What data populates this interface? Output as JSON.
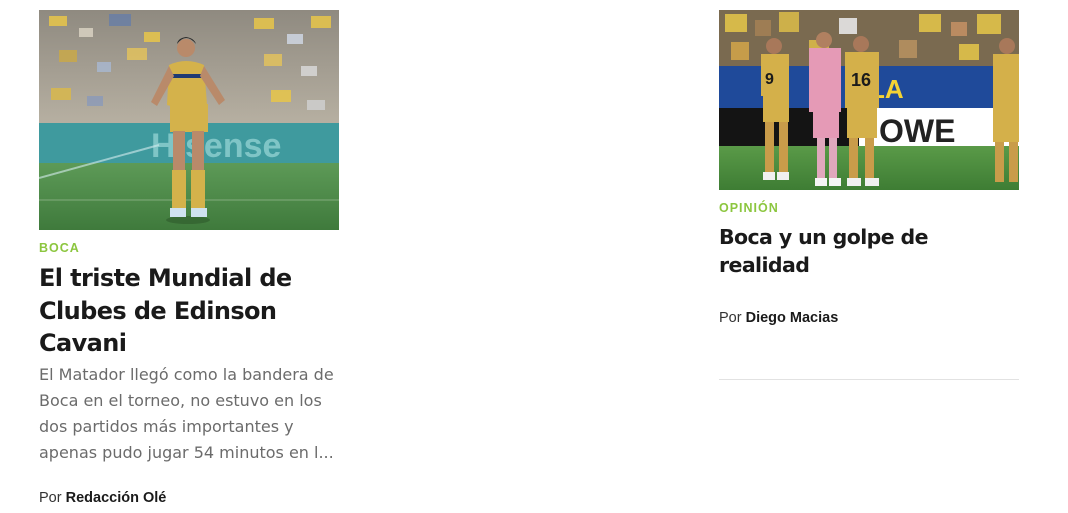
{
  "colors": {
    "section_tag": "#8cc63f",
    "headline": "#1a1a1a",
    "summary": "#6b6b6b",
    "divider": "#e2e2e2"
  },
  "articles": [
    {
      "image_alt": "Edinson Cavani en el campo con la camiseta de Boca",
      "section": "BOCA",
      "title": "El triste Mundial de Clubes de Edinson Cavani",
      "summary": "El Matador llegó como la bandera de Boca en el torneo, no estuvo en los dos partidos más importantes y apenas pudo jugar 54 minutos en l...",
      "byline_prefix": "Por",
      "author": "Redacción Olé"
    },
    {
      "image_alt": "Jugadores de Boca reunidos en el campo",
      "section": "OPINIÓN",
      "title": "Boca y un golpe de realidad",
      "byline_prefix": "Por",
      "author": "Diego Macias"
    }
  ]
}
